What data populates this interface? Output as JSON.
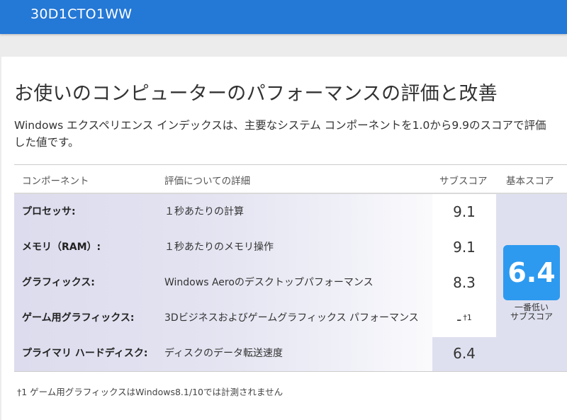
{
  "header": {
    "title": "30D1CTO1WW"
  },
  "main": {
    "heading": "お使いのコンピューターのパフォーマンスの評価と改善",
    "description": "Windows エクスペリエンス インデックスは、主要なシステム コンポーネントを1.0から9.9のスコアで評価した値です。"
  },
  "table": {
    "columns": {
      "component": "コンポーネント",
      "detail": "評価についての詳細",
      "subscore": "サブスコア",
      "base": "基本スコア"
    },
    "rows": [
      {
        "component": "プロセッサ:",
        "detail": "１秒あたりの計算",
        "subscore": "9.1",
        "note": ""
      },
      {
        "component": "メモリ（RAM）:",
        "detail": "１秒あたりのメモリ操作",
        "subscore": "9.1",
        "note": ""
      },
      {
        "component": "グラフィックス:",
        "detail": "Windows Aeroのデスクトップパフォーマンス",
        "subscore": "8.3",
        "note": ""
      },
      {
        "component": "ゲーム用グラフィックス:",
        "detail": "3Dビジネスおよびゲームグラフィックス パフォーマンス",
        "subscore": "-",
        "note": "†1"
      },
      {
        "component": "プライマリ ハードディスク:",
        "detail": "ディスクのデータ転送速度",
        "subscore": "6.4",
        "note": ""
      }
    ],
    "base_score": "6.4",
    "base_caption_line1": "一番低い",
    "base_caption_line2": "サブスコア"
  },
  "footnote": "†1 ゲーム用グラフィックスはWindows8.1/10では計測されません",
  "colors": {
    "topbar": "#2478d6",
    "score_box": "#2d9af0",
    "base_column": "#dfe0ef"
  }
}
